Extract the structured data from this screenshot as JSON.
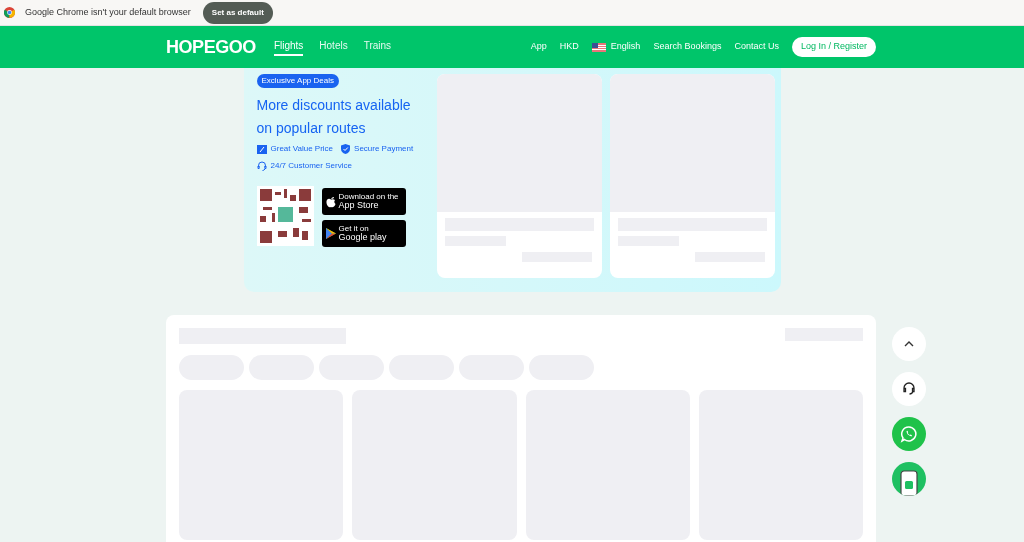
{
  "browser_infobar": {
    "message": "Google Chrome isn't your default browser",
    "button": "Set as default"
  },
  "header": {
    "logo": "HOPEGOO",
    "tabs": [
      {
        "label": "Flights",
        "selected": true
      },
      {
        "label": "Hotels",
        "selected": false
      },
      {
        "label": "Trains",
        "selected": false
      }
    ],
    "links": [
      "App",
      "HKD"
    ],
    "language": "English",
    "links_right": [
      "Search Bookings",
      "Contact Us"
    ],
    "login": "Log In / Register"
  },
  "promo": {
    "badge": "Exclusive App Deals",
    "title": "More discounts available on popular routes",
    "features": [
      {
        "kind": "price",
        "label": "Great Value Price"
      },
      {
        "kind": "secure",
        "label": "Secure Payment"
      },
      {
        "kind": "service",
        "label": "24/7 Customer Service"
      }
    ],
    "app_store": {
      "small": "Download on the",
      "big": "App Store"
    },
    "google_play": {
      "small": "Get it on",
      "big": "Google play"
    }
  }
}
